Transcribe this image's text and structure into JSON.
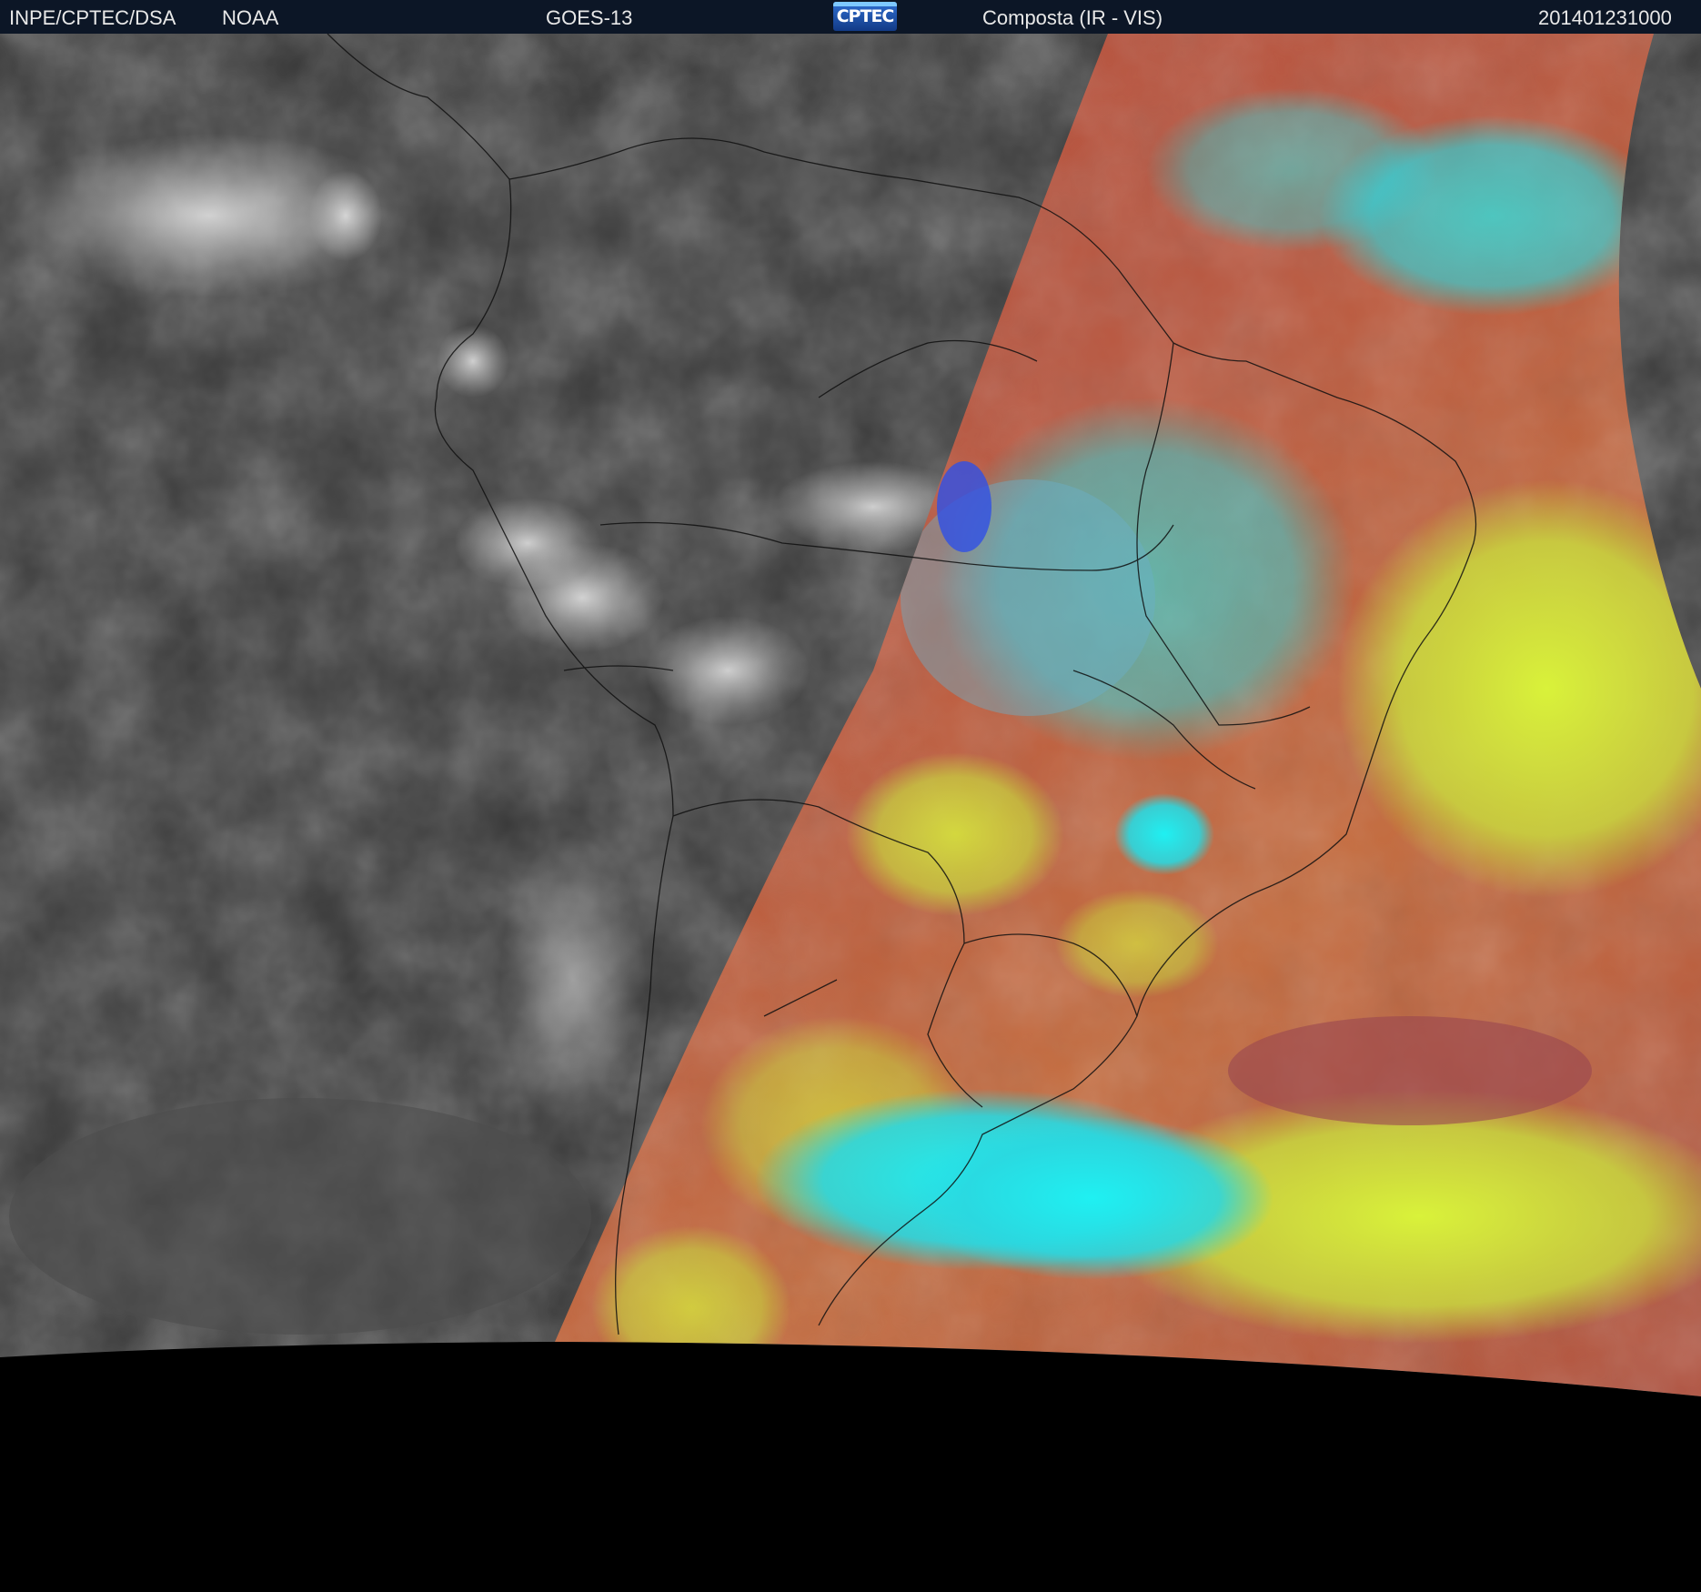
{
  "header": {
    "source": "INPE/CPTEC/DSA",
    "agency": "NOAA",
    "satellite": "GOES-13",
    "logo_text": "CPTEC",
    "product": "Composta (IR - VIS)",
    "timestamp": "201401231000"
  },
  "colors": {
    "header_bg": "#0c1626",
    "night_gray": "#3a3a3a",
    "day_red": "#b5513f",
    "day_cyan": "#20e6ea",
    "day_yellow": "#d6e23a",
    "space": "#000000"
  }
}
